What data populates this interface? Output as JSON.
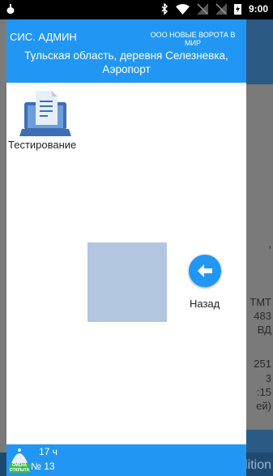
{
  "status_bar": {
    "time": "9:00"
  },
  "drawer": {
    "user_name": "СИС. АДМИН",
    "company": "ООО НОВЫЕ ВОРОТА В МИР",
    "address": "Тульская область, деревня Селезневка, Аэропорт",
    "menu": [
      {
        "label": "Тестирование",
        "icon": "laptop-document-icon"
      }
    ],
    "back_label": "Назад",
    "footer": {
      "hours": "17 ч",
      "shift_badge": "СМЕНА ОТКРЫТА",
      "shift_number": "№ 13"
    }
  },
  "background": {
    "partial_text": [
      ",",
      "ТМТ",
      "483",
      "ВД",
      "251",
      "3",
      ":15",
      "ей)"
    ],
    "watermark": "Developer Edition"
  },
  "colors": {
    "primary": "#2196f3",
    "shift_green": "#3dbb4a",
    "placeholder": "#b3c6df"
  }
}
